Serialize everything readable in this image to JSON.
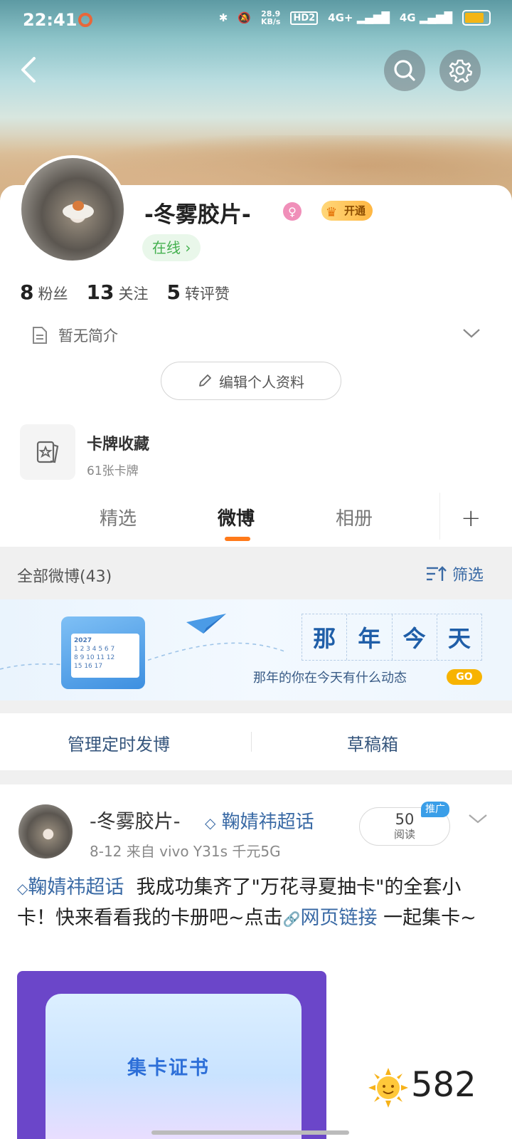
{
  "status_bar": {
    "time": "22:41",
    "net_speed": "28.9\nKB/s",
    "hd": "HD2",
    "signal1": "4G+",
    "signal2": "4G"
  },
  "header": {
    "back": "back",
    "search": "search",
    "settings": "settings"
  },
  "profile": {
    "name": "-冬雾胶片-",
    "gender_icon": "female",
    "vip_label": "开通",
    "online": "在线 ›",
    "stats": [
      {
        "num": "8",
        "label": "粉丝"
      },
      {
        "num": "13",
        "label": "关注"
      },
      {
        "num": "5",
        "label": "转评赞"
      }
    ],
    "intro": "暂无简介",
    "edit_label": "编辑个人资料"
  },
  "collection": {
    "title": "卡牌收藏",
    "subtitle": "61张卡牌"
  },
  "tabs": {
    "items": [
      "精选",
      "微博",
      "相册"
    ],
    "active": "微博",
    "add": "+"
  },
  "filter": {
    "all": "全部微博(43)",
    "filter_label": "筛选"
  },
  "promo": {
    "chars": [
      "那",
      "年",
      "今",
      "天"
    ],
    "subtitle": "那年的你在今天有什么动态",
    "go": "GO",
    "cal_year": "2027"
  },
  "actions": {
    "schedule": "管理定时发博",
    "drafts": "草稿箱"
  },
  "post": {
    "author": "-冬雾胶片-",
    "topic": "鞠婧祎超话",
    "meta": "8-12  来自 vivo Y31s 千元5G",
    "reads_num": "50",
    "reads_label": "阅读",
    "promote": "推广",
    "body_topic": "鞠婧祎超话",
    "body_text": "我成功集齐了\"万花寻夏抽卡\"的全套小卡！快来看看我的卡册吧~点击",
    "body_link": "网页链接",
    "body_end": " 一起集卡~",
    "image_title": "集卡证书",
    "likes": "582"
  },
  "colors": {
    "accent": "#ff7a1a",
    "link": "#3a6aa5",
    "online": "#44b04f",
    "vip": "#ffb743"
  }
}
